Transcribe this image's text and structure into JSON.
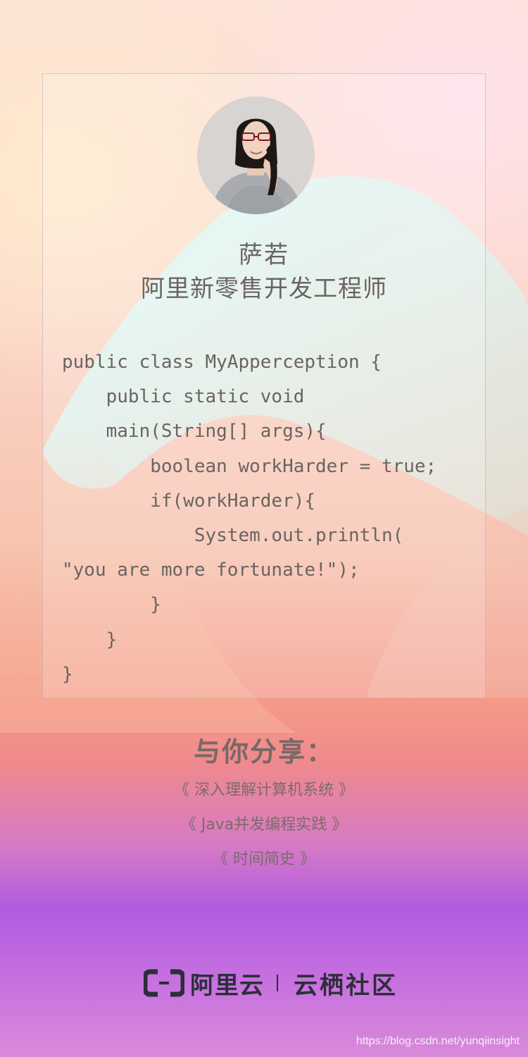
{
  "profile": {
    "name": "萨若",
    "role": "阿里新零售开发工程师",
    "avatar_icon": "woman-portrait-avatar"
  },
  "code_lines": [
    "public class MyApperception {",
    "    public static void",
    "    main(String[] args){",
    "        boolean workHarder = true;",
    "        if(workHarder){",
    "            System.out.println(",
    "\"you are more fortunate!\");",
    "        }",
    "    }",
    "}"
  ],
  "share": {
    "heading": "与你分享：",
    "books": [
      "《 深入理解计算机系统 》",
      "《 Java并发编程实践 》",
      "《 时间简史 》"
    ]
  },
  "brand": {
    "logo_icon": "aliyun-bracket-logo",
    "aliyun": "阿里云",
    "community": "云栖社区"
  },
  "watermark": "https://blog.csdn.net/yunqiinsight",
  "colors": {
    "text": "#6b6461",
    "brand_dark": "#2c2f39",
    "brand_blue": "#3a5cff"
  }
}
